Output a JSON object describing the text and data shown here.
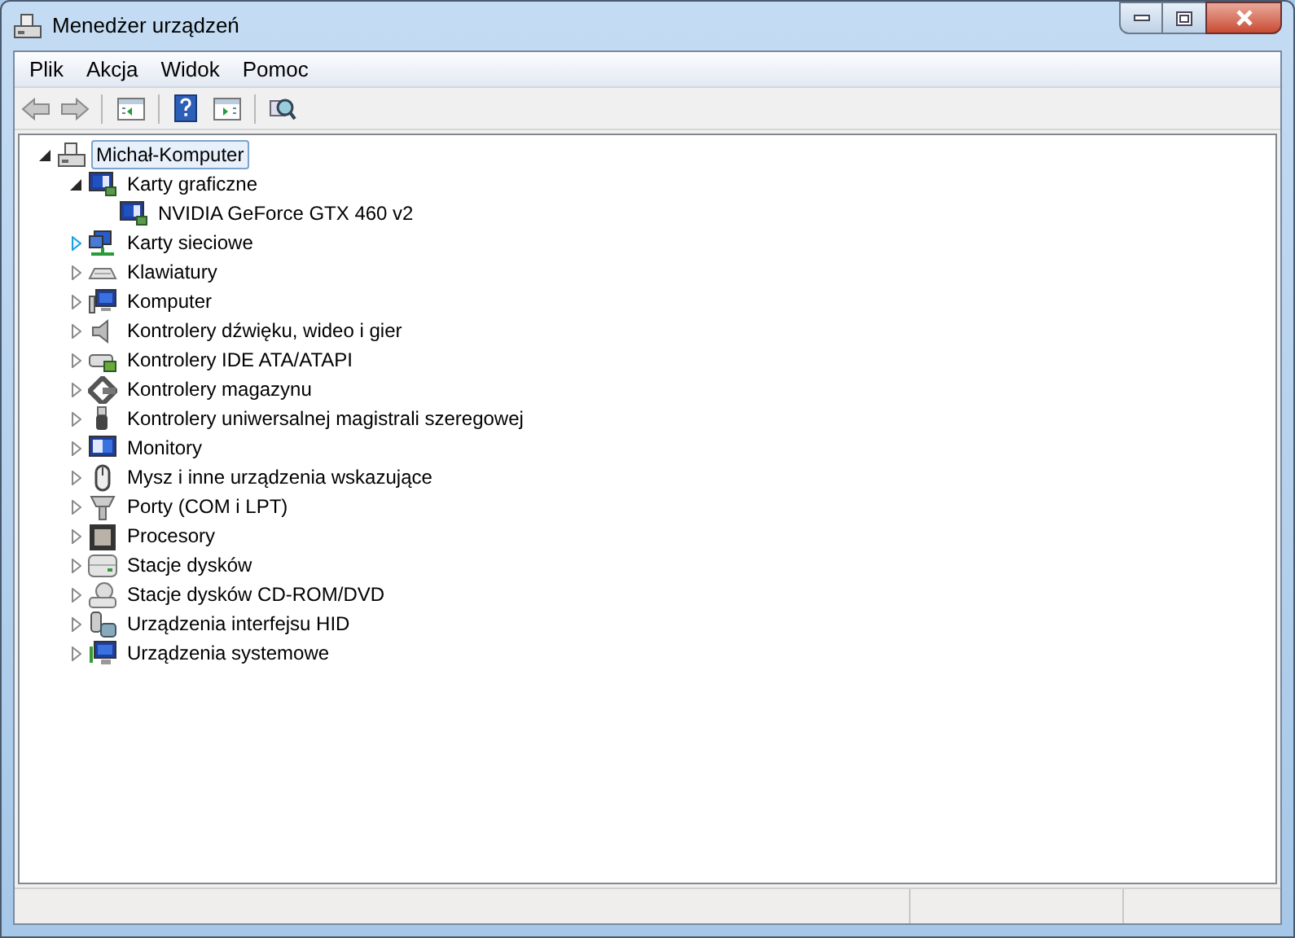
{
  "window": {
    "title": "Menedżer urządzeń"
  },
  "menu": [
    {
      "label": "Plik"
    },
    {
      "label": "Akcja"
    },
    {
      "label": "Widok"
    },
    {
      "label": "Pomoc"
    }
  ],
  "tree": [
    {
      "label": "Michał-Komputer",
      "expanded": true,
      "selected": true,
      "hot": false,
      "children": [
        {
          "label": "Karty graficzne",
          "expanded": true,
          "selected": false,
          "hot": false,
          "children": [
            {
              "label": "NVIDIA GeForce GTX 460 v2",
              "selected": false,
              "hot": false
            }
          ]
        },
        {
          "label": "Karty sieciowe",
          "expanded": false,
          "selected": false,
          "hot": true
        },
        {
          "label": "Klawiatury",
          "expanded": false,
          "selected": false,
          "hot": false
        },
        {
          "label": "Komputer",
          "expanded": false,
          "selected": false,
          "hot": false
        },
        {
          "label": "Kontrolery dźwięku, wideo i gier",
          "expanded": false,
          "selected": false,
          "hot": false
        },
        {
          "label": "Kontrolery IDE ATA/ATAPI",
          "expanded": false,
          "selected": false,
          "hot": false
        },
        {
          "label": "Kontrolery magazynu",
          "expanded": false,
          "selected": false,
          "hot": false
        },
        {
          "label": "Kontrolery uniwersalnej magistrali szeregowej",
          "expanded": false,
          "selected": false,
          "hot": false
        },
        {
          "label": "Monitory",
          "expanded": false,
          "selected": false,
          "hot": false
        },
        {
          "label": "Mysz i inne urządzenia wskazujące",
          "expanded": false,
          "selected": false,
          "hot": false
        },
        {
          "label": "Porty (COM i LPT)",
          "expanded": false,
          "selected": false,
          "hot": false
        },
        {
          "label": "Procesory",
          "expanded": false,
          "selected": false,
          "hot": false
        },
        {
          "label": "Stacje dysków",
          "expanded": false,
          "selected": false,
          "hot": false
        },
        {
          "label": "Stacje dysków CD-ROM/DVD",
          "expanded": false,
          "selected": false,
          "hot": false
        },
        {
          "label": "Urządzenia interfejsu HID",
          "expanded": false,
          "selected": false,
          "hot": false
        },
        {
          "label": "Urządzenia systemowe",
          "expanded": false,
          "selected": false,
          "hot": false
        }
      ]
    }
  ]
}
